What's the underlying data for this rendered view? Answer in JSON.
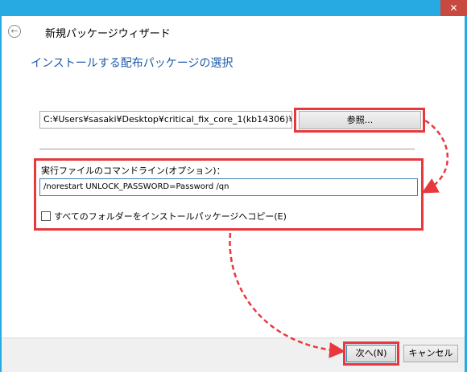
{
  "window": {
    "title": "新規パッケージウィザード",
    "close_label": "✕"
  },
  "page": {
    "heading": "インストールする配布パッケージの選択"
  },
  "source": {
    "path_value": "C:¥Users¥sasaki¥Desktop¥critical_fix_core_1(kb14306)¥critica",
    "browse_label": "参照..."
  },
  "command": {
    "label": "実行ファイルのコマンドライン(オプション)：",
    "value": "/norestart UNLOCK_PASSWORD=Password /qn",
    "copy_all_label": "すべてのフォルダーをインストールパッケージへコピー(E)",
    "copy_all_checked": false
  },
  "footer": {
    "next_label": "次へ(N)",
    "cancel_label": "キャンセル"
  },
  "colors": {
    "frame": "#27aae1",
    "highlight": "#e8383d",
    "heading": "#1f5aa8"
  }
}
